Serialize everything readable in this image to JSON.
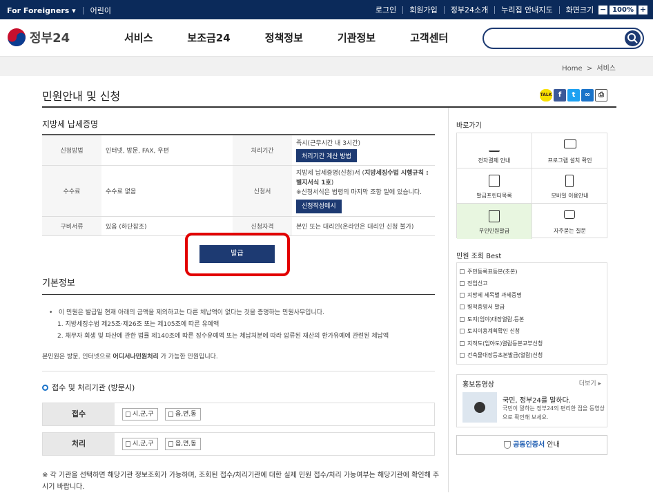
{
  "topbar": {
    "foreigners": "For Foreigners",
    "kids": "어린이",
    "links": [
      "로그인",
      "회원가입",
      "정부24소개",
      "누리집 안내지도"
    ],
    "zoom_label": "화면크기",
    "zoom_value": "100%"
  },
  "header": {
    "logo": "정부24",
    "nav": [
      "서비스",
      "보조금24",
      "정책정보",
      "기관정보",
      "고객센터"
    ],
    "search_placeholder": ""
  },
  "breadcrumb": {
    "home": "Home",
    "sep": ">",
    "current": "서비스"
  },
  "page": {
    "title": "민원안내 및 신청",
    "subtitle": "지방세 납세증명"
  },
  "share": {
    "kakao": "TALK",
    "facebook": "f",
    "twitter": "t",
    "link": "∞",
    "print": "⎙"
  },
  "info": {
    "method_label": "신청방법",
    "method_value": "인터넷, 방문, FAX, 우편",
    "period_label": "처리기간",
    "period_value": "즉시(근무시간 내 3시간)",
    "period_button": "처리기간 계산 방법",
    "fee_label": "수수료",
    "fee_value": "수수료 없음",
    "form_label": "신청서",
    "form_value_1": "지방세 납세증명(신청)서 (",
    "form_value_bold": "지방세징수법 시행규칙 : 별지서식 1호",
    "form_value_2": ")",
    "form_note": "※신청서식은 법령의 마지막 조항 밑에 있습니다.",
    "form_button": "신청작성예시",
    "docs_label": "구비서류",
    "docs_value": "있음 (하단참조)",
    "qual_label": "신청자격",
    "qual_value": "본인 또는 대리인(온라인은 대리인 신청 불가)"
  },
  "issue_button": "발급",
  "basic": {
    "title": "기본정보",
    "bullet": "이 민원은 발급일 현재 아래의 금액을 제외하고는 다른 체납액이 없다는 것을 증명하는 민원사무입니다.",
    "item1": "1. 지방세징수법 제25조·제26조 또는 제105조에 따른 유예액",
    "item2": "2. 채무자 회생 및 파산에 관한 법률 제140조에 따른 징수유예액 또는 체납처분에 따라 압류된 재산의 환가유예에 관련된 체납액",
    "note_pre": "본민원은 방문, 인터넷으로 ",
    "note_bold": "어디서나민원처리",
    "note_post": " 가 가능한 민원입니다."
  },
  "office": {
    "title": "접수 및 처리기관 (방문시)",
    "receive_label": "접수",
    "process_label": "처리",
    "chip1": "시,군,구",
    "chip2": "읍,면,동",
    "note": "※ 각 기관을 선택하면 해당기관 정보조회가 가능하며, 조회된 접수/처리기관에 대한 실제 민원 접수/처리 가능여부는 해당기관에 확인해 주시기 바랍니다."
  },
  "side": {
    "quick_title": "바로가기",
    "quick": [
      "전자결제 안내",
      "프로그램 설치 확인",
      "발급프린터목록",
      "모바일 이용안내",
      "무인민원발급",
      "자주묻는 질문"
    ],
    "best_title": "민원 조회 Best",
    "best": [
      "주민등록표등본(초본)",
      "전입신고",
      "지방세 세목별 과세증명",
      "병적증명서 발급",
      "토지(임야)대장열람.등본",
      "토지이용계획확인 신청",
      "지적도(임야도)열람등본교부신청",
      "건축물대장등초본발급(열람)신청"
    ],
    "promo_title": "홍보동영상",
    "promo_more": "더보기",
    "promo_headline": "국민, 정부24를 말하다.",
    "promo_desc": "국민이 말하는 정부24의 편리한 점을 동영상으로 확인해 보세요.",
    "cert_bold": "공동인증서",
    "cert_rest": " 안내"
  },
  "colors": {
    "navy": "#0b2a5a",
    "primary": "#1d3a72",
    "highlight": "#e20000"
  }
}
